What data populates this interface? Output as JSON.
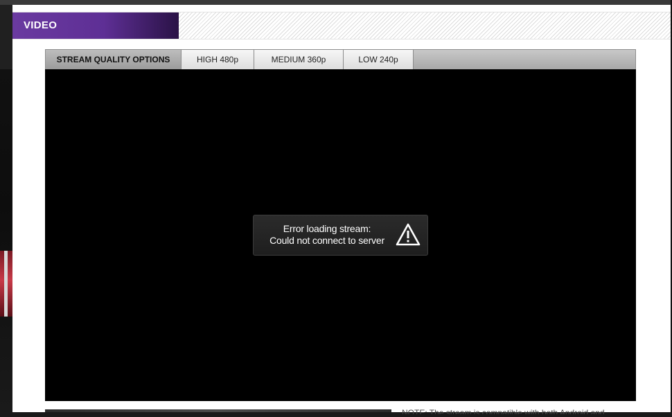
{
  "section": {
    "title": "VIDEO"
  },
  "tabs": {
    "label": "STREAM QUALITY OPTIONS",
    "items": [
      {
        "label": "HIGH 480p"
      },
      {
        "label": "MEDIUM 360p"
      },
      {
        "label": "LOW 240p"
      }
    ]
  },
  "player": {
    "error_line1": "Error loading stream:",
    "error_line2": "Could not connect to server",
    "error_icon": "warning-triangle-icon"
  },
  "note": {
    "text": "NOTE: The stream is compatible with both Android and"
  },
  "colors": {
    "header_purple": "#6a3aa0",
    "player_bg": "#000000"
  }
}
